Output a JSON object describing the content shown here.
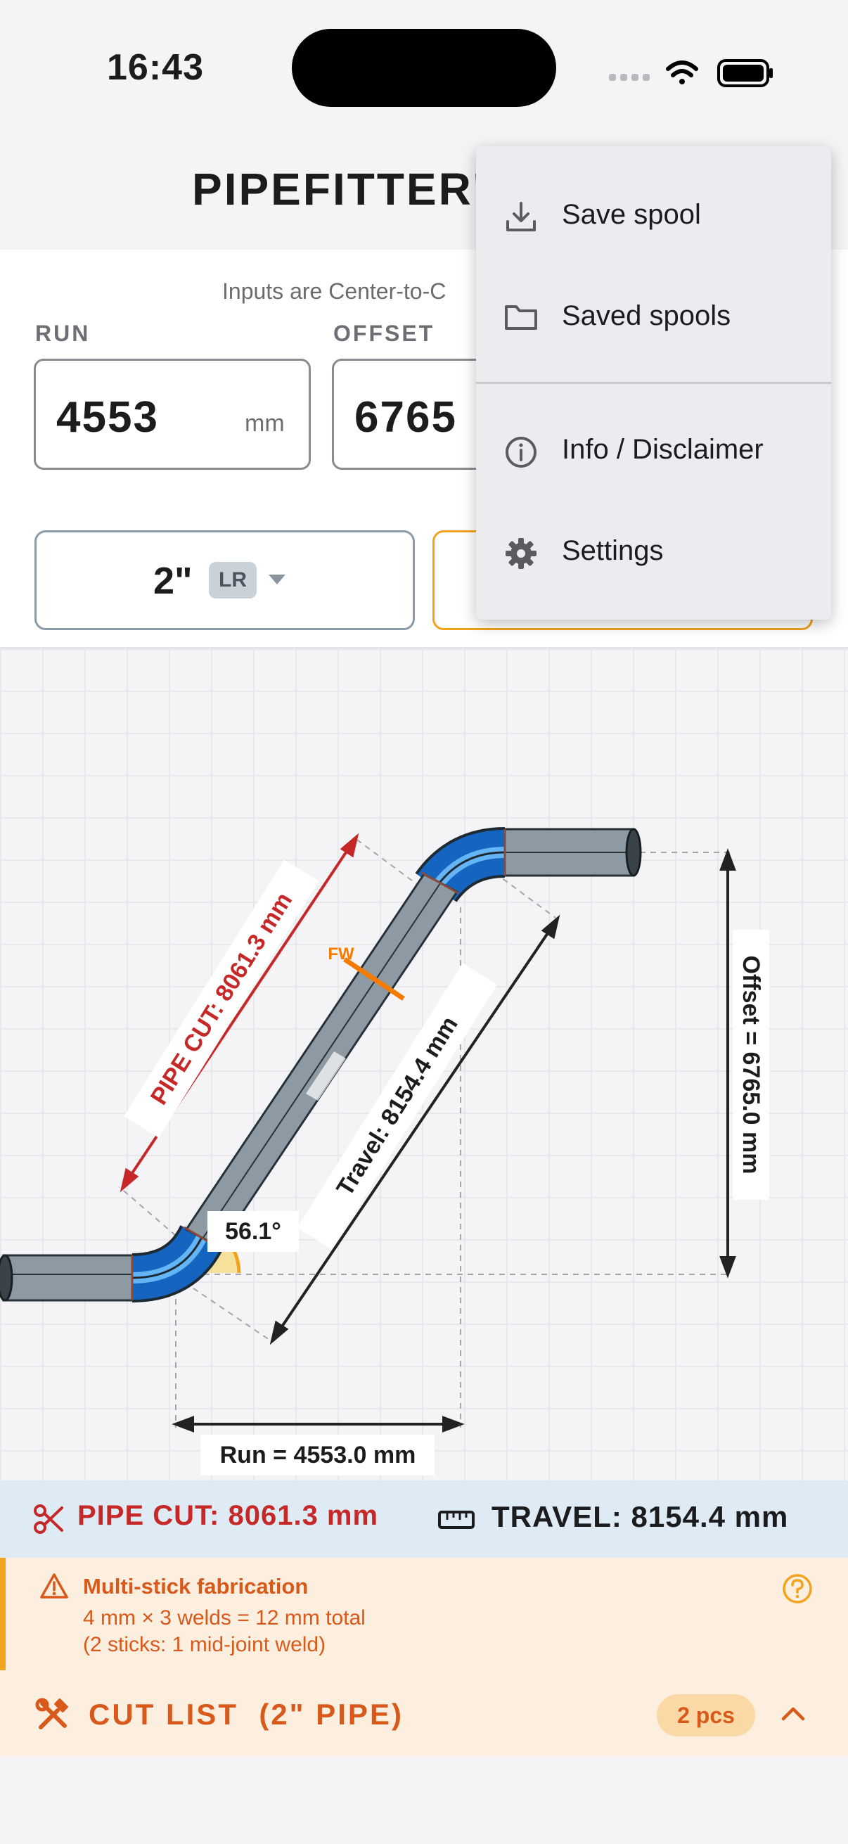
{
  "status_bar": {
    "time": "16:43"
  },
  "header": {
    "title": "PIPEFITTER'"
  },
  "inputs": {
    "hint": "Inputs are Center-to-C",
    "run_label": "RUN",
    "run_value": "4553",
    "run_unit": "mm",
    "offset_label": "OFFSET",
    "offset_value": "6765"
  },
  "pipe_size": {
    "size": "2\"",
    "radius_badge": "LR"
  },
  "diagram": {
    "pipe_cut_label": "PIPE CUT: 8061.3 mm",
    "field_weld_label": "FW",
    "travel_label": "Travel: 8154.4 mm",
    "offset_label": "Offset = 6765.0 mm",
    "angle_label": "56.1°",
    "run_label": "Run = 4553.0 mm"
  },
  "results": {
    "pipe_cut": "PIPE CUT: 8061.3 mm",
    "travel": "TRAVEL: 8154.4 mm"
  },
  "warning": {
    "title": "Multi-stick fabrication",
    "line1": "4 mm × 3 welds = 12 mm total",
    "line2": "(2 sticks: 1 mid-joint weld)"
  },
  "cut_list": {
    "title": "CUT LIST  (2\" PIPE)",
    "count": "2 pcs"
  },
  "menu": {
    "items": [
      {
        "label": "Save spool",
        "icon": "download-icon"
      },
      {
        "label": "Saved spools",
        "icon": "folder-icon"
      },
      {
        "label": "Info / Disclaimer",
        "icon": "info-icon"
      },
      {
        "label": "Settings",
        "icon": "gear-icon"
      }
    ]
  },
  "colors": {
    "accent_orange": "#f2a21b",
    "cut_red": "#c62828",
    "warning_text": "#d9591a",
    "elbow_blue": "#1565c0",
    "pipe_gray": "#8d9aa3"
  }
}
